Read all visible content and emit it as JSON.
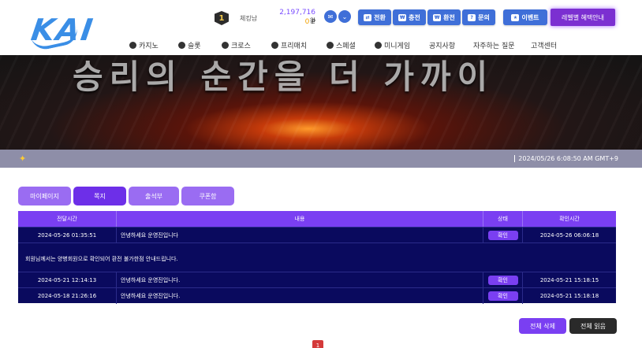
{
  "header": {
    "logo_text": "KAI",
    "level": "1",
    "username": "체킹남",
    "balance": "2,197,716",
    "balance_unit": "원",
    "points": "0",
    "points_unit": "P",
    "buttons": [
      {
        "label": "전환",
        "icon": "exchange-icon"
      },
      {
        "label": "충전",
        "icon": "deposit-icon"
      },
      {
        "label": "환전",
        "icon": "withdraw-icon"
      },
      {
        "label": "문의",
        "icon": "headset-icon"
      },
      {
        "label": "이벤트",
        "icon": "gift-icon"
      }
    ],
    "level_benefit_button": "레벨별 혜택안내"
  },
  "nav": {
    "items": [
      "카지노",
      "슬롯",
      "크로스",
      "프리매치",
      "스페셜",
      "미니게임",
      "공지사항",
      "자주하는 질문",
      "고객센터"
    ]
  },
  "banner": {
    "text": "승리의 순간을 더 가까이"
  },
  "notice_bar": {
    "datetime": "2024/05/26 6:08:50 AM GMT+9"
  },
  "tabs": [
    "마이페이지",
    "쪽지",
    "출석부",
    "쿠폰함"
  ],
  "active_tab": "쪽지",
  "table": {
    "headers": [
      "전달시간",
      "내용",
      "상태",
      "확인시간"
    ],
    "rows": [
      {
        "sent": "2024-05-26 01:35:51",
        "content": "안녕하세요 운영진입니다",
        "status": "확인",
        "read": "2024-05-26 06:06:18"
      },
      {
        "sent": "2024-05-21 12:14:13",
        "content": "안녕하세요 운영진입니다.",
        "status": "확인",
        "read": "2024-05-21 15:18:15"
      },
      {
        "sent": "2024-05-18 21:26:16",
        "content": "안녕하세요 운영진입니다.",
        "status": "확인",
        "read": "2024-05-21 15:18:18"
      }
    ],
    "expanded_message": "회원님께서는 양병회원으로 확인되어 환전 불가한점 안내드립니다."
  },
  "actions": {
    "delete_all": "전체 삭제",
    "read_all": "전체 읽음"
  },
  "pagination": {
    "current": "1"
  },
  "colors": {
    "accent": "#7a3ff2",
    "header_button": "#3f6fd8",
    "table_bg": "#0a0a5e",
    "logo": "#3a8ee6"
  }
}
